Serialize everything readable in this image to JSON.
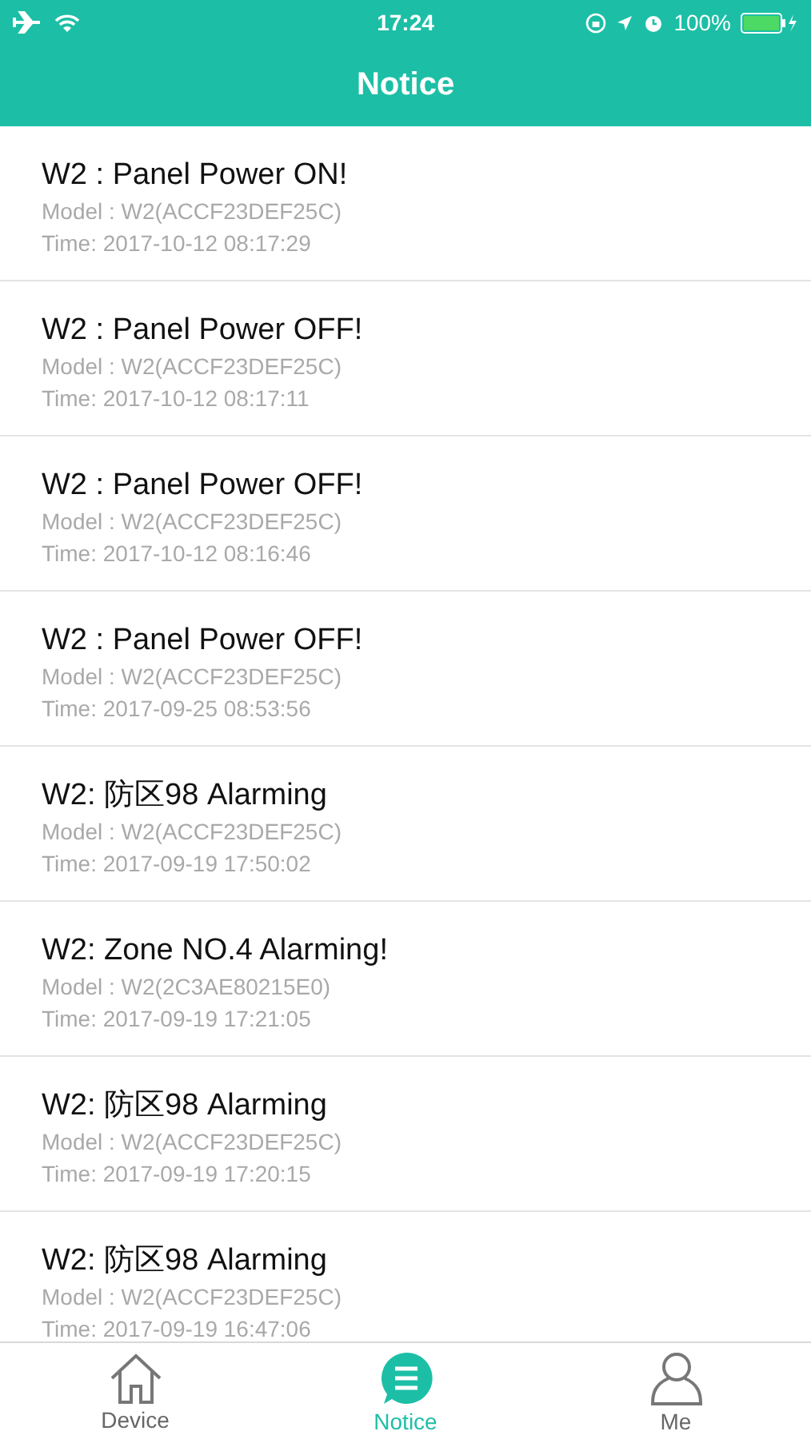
{
  "status_bar": {
    "time": "17:24",
    "battery": "100%"
  },
  "header": {
    "title": "Notice"
  },
  "notices": [
    {
      "title": "W2 : Panel Power ON!",
      "model": "Model : W2(ACCF23DEF25C)",
      "time": "Time: 2017-10-12 08:17:29"
    },
    {
      "title": "W2 : Panel Power OFF!",
      "model": "Model : W2(ACCF23DEF25C)",
      "time": "Time: 2017-10-12 08:17:11"
    },
    {
      "title": "W2 : Panel Power OFF!",
      "model": "Model : W2(ACCF23DEF25C)",
      "time": "Time: 2017-10-12 08:16:46"
    },
    {
      "title": "W2 : Panel Power OFF!",
      "model": "Model : W2(ACCF23DEF25C)",
      "time": "Time: 2017-09-25 08:53:56"
    },
    {
      "title": "W2: 防区98 Alarming",
      "model": "Model : W2(ACCF23DEF25C)",
      "time": "Time: 2017-09-19 17:50:02"
    },
    {
      "title": "W2: Zone NO.4 Alarming!",
      "model": "Model : W2(2C3AE80215E0)",
      "time": "Time: 2017-09-19 17:21:05"
    },
    {
      "title": "W2: 防区98 Alarming",
      "model": "Model : W2(ACCF23DEF25C)",
      "time": "Time: 2017-09-19 17:20:15"
    },
    {
      "title": "W2: 防区98 Alarming",
      "model": "Model : W2(ACCF23DEF25C)",
      "time": "Time: 2017-09-19 16:47:06"
    }
  ],
  "tabs": [
    {
      "label": "Device",
      "kind": "home",
      "selected": false
    },
    {
      "label": "Notice",
      "kind": "notice",
      "selected": true
    },
    {
      "label": "Me",
      "kind": "person",
      "selected": false
    }
  ]
}
